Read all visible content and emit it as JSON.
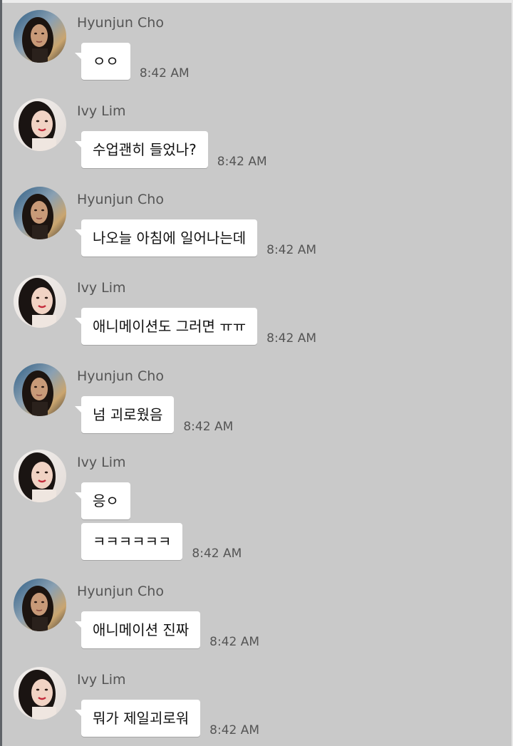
{
  "conversation": {
    "groups": [
      {
        "sender": "Hyunjun Cho",
        "avatar": "hyunjun-avatar",
        "messages": [
          {
            "text": "ㅇㅇ",
            "time": "8:42 AM"
          }
        ]
      },
      {
        "sender": "Ivy Lim",
        "avatar": "ivy-avatar",
        "messages": [
          {
            "text": "수업괜히 들었나?",
            "time": "8:42 AM"
          }
        ]
      },
      {
        "sender": "Hyunjun Cho",
        "avatar": "hyunjun-avatar",
        "messages": [
          {
            "text": "나오늘 아침에 일어나는데",
            "time": "8:42 AM"
          }
        ]
      },
      {
        "sender": "Ivy Lim",
        "avatar": "ivy-avatar",
        "messages": [
          {
            "text": "애니메이션도 그러면 ㅠㅠ",
            "time": "8:42 AM"
          }
        ]
      },
      {
        "sender": "Hyunjun Cho",
        "avatar": "hyunjun-avatar",
        "messages": [
          {
            "text": "넘 괴로웠음",
            "time": "8:42 AM"
          }
        ]
      },
      {
        "sender": "Ivy Lim",
        "avatar": "ivy-avatar",
        "messages": [
          {
            "text": "응ㅇ",
            "time": ""
          },
          {
            "text": "ㅋㅋㅋㅋㅋㅋ",
            "time": "8:42 AM"
          }
        ]
      },
      {
        "sender": "Hyunjun Cho",
        "avatar": "hyunjun-avatar",
        "messages": [
          {
            "text": "애니메이션 진짜",
            "time": "8:42 AM"
          }
        ]
      },
      {
        "sender": "Ivy Lim",
        "avatar": "ivy-avatar",
        "messages": [
          {
            "text": "뭐가 제일괴로워",
            "time": "8:42 AM"
          }
        ]
      }
    ]
  },
  "colors": {
    "background": "#c9c9c9",
    "bubble": "#ffffff",
    "meta_text": "#555555",
    "message_text": "#111111"
  }
}
